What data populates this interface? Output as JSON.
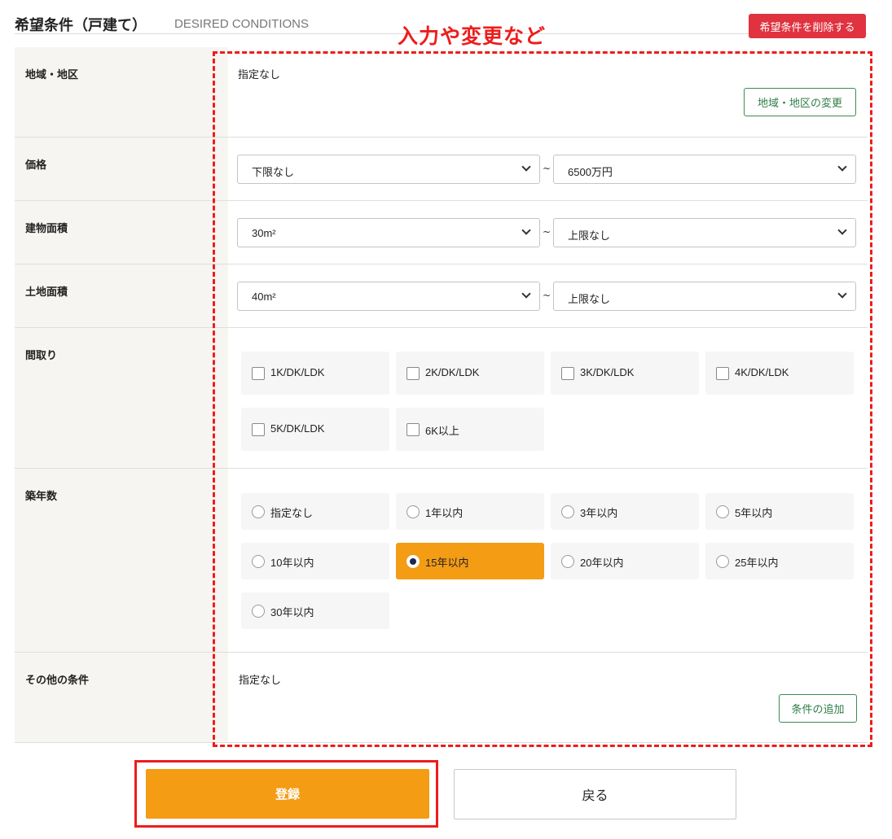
{
  "header": {
    "title": "希望条件（戸建て）",
    "subtitle": "DESIRED CONDITIONS",
    "delete_label": "希望条件を削除する"
  },
  "annotation": {
    "text": "入力や変更など"
  },
  "area": {
    "label": "地域・地区",
    "value": "指定なし",
    "change_label": "地域・地区の変更"
  },
  "price": {
    "label": "価格",
    "min": "下限なし",
    "separator": "~",
    "max": "6500万円"
  },
  "building_area": {
    "label": "建物面積",
    "min": "30m²",
    "separator": "~",
    "max": "上限なし"
  },
  "land_area": {
    "label": "土地面積",
    "min": "40m²",
    "separator": "~",
    "max": "上限なし"
  },
  "layout": {
    "label": "間取り",
    "options": [
      "1K/DK/LDK",
      "2K/DK/LDK",
      "3K/DK/LDK",
      "4K/DK/LDK",
      "5K/DK/LDK",
      "6K以上"
    ]
  },
  "age": {
    "label": "築年数",
    "options": [
      "指定なし",
      "1年以内",
      "3年以内",
      "5年以内",
      "10年以内",
      "15年以内",
      "20年以内",
      "25年以内",
      "30年以内"
    ],
    "selected": "15年以内"
  },
  "other": {
    "label": "その他の条件",
    "value": "指定なし",
    "add_label": "条件の追加"
  },
  "actions": {
    "submit_label": "登録",
    "back_label": "戻る"
  }
}
